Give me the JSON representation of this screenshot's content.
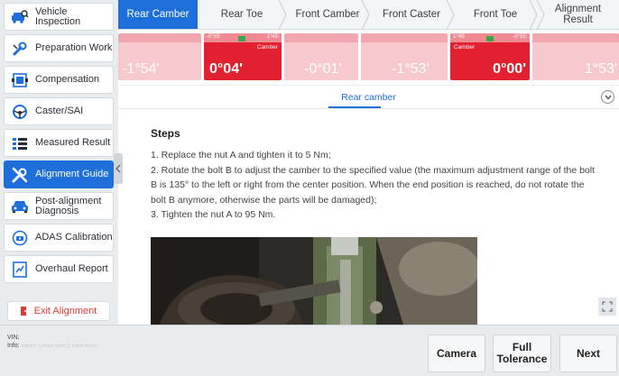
{
  "sidebar": {
    "items": [
      {
        "label": "Vehicle Inspection",
        "icon": "car-search-icon"
      },
      {
        "label": "Preparation Work",
        "icon": "wrench-icon"
      },
      {
        "label": "Compensation",
        "icon": "compensation-icon"
      },
      {
        "label": "Caster/SAI",
        "icon": "steering-wheel-icon"
      },
      {
        "label": "Measured Result",
        "icon": "list-icon"
      },
      {
        "label": "Alignment Guide",
        "icon": "tools-icon"
      },
      {
        "label": "Post-alignment Diagnosis",
        "icon": "car-icon"
      },
      {
        "label": "ADAS Calibration",
        "icon": "adas-icon"
      },
      {
        "label": "Overhaul Report",
        "icon": "report-icon"
      }
    ],
    "active_index": 5,
    "exit_label": "Exit Alignment"
  },
  "tabs": [
    {
      "label": "Rear Camber",
      "active": true
    },
    {
      "label": "Rear Toe",
      "active": false
    },
    {
      "label": "Front Camber",
      "active": false
    },
    {
      "label": "Front Caster",
      "active": false
    },
    {
      "label": "Front Toe",
      "active": false
    },
    {
      "label": "Alignment Result",
      "active": false
    }
  ],
  "gauges": [
    {
      "value": "-1°54'",
      "label": "",
      "min": "",
      "max": "",
      "style": "dim"
    },
    {
      "value": "0°04'",
      "label": "Camber",
      "min": "-0°55'",
      "max": "1°45'",
      "style": "red"
    },
    {
      "value": "-0°01'",
      "label": "",
      "min": "",
      "max": "",
      "style": "dim"
    },
    {
      "value": "-1°53'",
      "label": "",
      "min": "",
      "max": "",
      "style": "dim"
    },
    {
      "value": "0°00'",
      "label": "Camber",
      "min": "1°45'",
      "max": "-0°55'",
      "style": "red"
    },
    {
      "value": "1°53'",
      "label": "",
      "min": "",
      "max": "",
      "style": "dim"
    }
  ],
  "subtab": {
    "label": "Rear camber"
  },
  "steps": {
    "title": "Steps",
    "items": [
      "1. Replace the nut A and tighten it to 5 Nm;",
      "2. Rotate the bolt B to adjust the camber to the specified value (the maximum adjustment range of the bolt B is 135° to the left or right from the center position. When the end position is reached, do not rotate the bolt B anymore, otherwise the parts will be damaged);",
      "3. Tighten the nut A to 95 Nm."
    ]
  },
  "footer": {
    "vin_label": "VIN:",
    "info_label": "Info:",
    "camera_label": "Camera",
    "tolerance_label": "Full Tolerance",
    "next_label": "Next"
  },
  "colors": {
    "accent": "#1e6fd9",
    "alert": "#e3202f",
    "exit": "#e53935"
  }
}
